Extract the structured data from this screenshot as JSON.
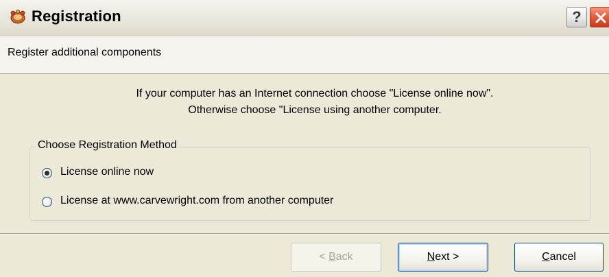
{
  "window": {
    "title": "Registration",
    "help_label": "?",
    "subtitle": "Register additional components"
  },
  "instructions": {
    "line1": "If your computer has an Internet connection choose \"License online now\".",
    "line2": "Otherwise choose \"License using another computer."
  },
  "group": {
    "legend": "Choose Registration Method",
    "options": [
      {
        "label": "License online now",
        "selected": true
      },
      {
        "label": "License at www.carvewright.com from another computer",
        "selected": false
      }
    ]
  },
  "buttons": {
    "back": {
      "mnemonic": "B",
      "rest": "ack",
      "prefix": "< ",
      "enabled": false
    },
    "next": {
      "mnemonic": "N",
      "rest": "ext >",
      "enabled": true
    },
    "cancel": {
      "mnemonic": "C",
      "rest": "ancel",
      "enabled": true
    }
  },
  "icons": {
    "app": "app-icon",
    "close": "close-icon"
  }
}
